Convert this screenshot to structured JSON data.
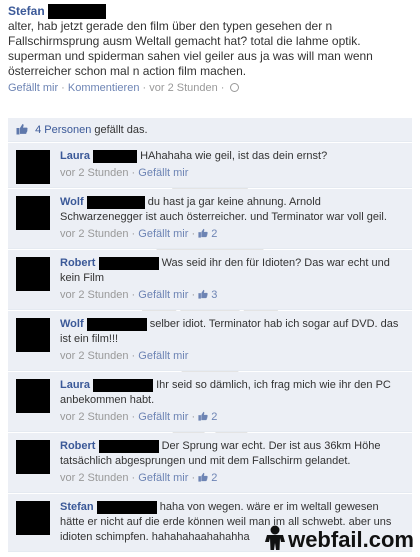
{
  "post": {
    "author": "Stefan",
    "text": "alter, hab jetzt gerade den film über den typen gesehen der n Fallschirmsprung ausm Weltall gemacht hat? total die lahme optik. superman und spiderman sahen viel geiler aus ja was will man wenn österreicher schon mal n action film machen.",
    "like_label": "Gefällt mir",
    "comment_label": "Kommentieren",
    "timestamp": "vor 2 Stunden"
  },
  "likes": {
    "text_link": "4 Personen",
    "text_rest": " gefällt das."
  },
  "comments": [
    {
      "author": "Laura",
      "text": "HAhahaha wie geil, ist das dein ernst?",
      "time": "vor 2 Stunden",
      "like_label": "Gefällt mir",
      "like_count": ""
    },
    {
      "author": "Wolf",
      "text": "du hast ja gar keine ahnung. Arnold Schwarzenegger ist auch österreicher. und Terminator war voll geil.",
      "time": "vor 2 Stunden",
      "like_label": "Gefällt mir",
      "like_count": "2"
    },
    {
      "author": "Robert",
      "text": "Was seid ihr den für Idioten? Das war echt und kein Film",
      "time": "vor 2 Stunden",
      "like_label": "Gefällt mir",
      "like_count": "3"
    },
    {
      "author": "Wolf",
      "text": "selber idiot. Terminator hab ich sogar auf DVD. das ist ein film!!!",
      "time": "vor 2 Stunden",
      "like_label": "Gefällt mir",
      "like_count": ""
    },
    {
      "author": "Laura",
      "text": "Ihr seid so dämlich, ich frag mich wie ihr den PC anbekommen habt.",
      "time": "vor 2 Stunden",
      "like_label": "Gefällt mir",
      "like_count": "2"
    },
    {
      "author": "Robert",
      "text": "Der Sprung war echt. Der ist aus 36km Höhe tatsächlich abgesprungen und mit dem Fallschirm gelandet.",
      "time": "vor 2 Stunden",
      "like_label": "Gefällt mir",
      "like_count": "2"
    },
    {
      "author": "Stefan",
      "text": "haha von wegen. wäre er im weltall gewesen hätte er nicht auf die erde können weil man im all schwebt. aber uns idioten schimpfen. hahahahaahahahha",
      "time": "",
      "like_label": "",
      "like_count": ""
    }
  ],
  "separator": " · ",
  "watermark": {
    "logo_text": "webfail.com"
  },
  "colors": {
    "link": "#3b5998",
    "comment_bg": "#eceff5",
    "meta": "#999999"
  }
}
